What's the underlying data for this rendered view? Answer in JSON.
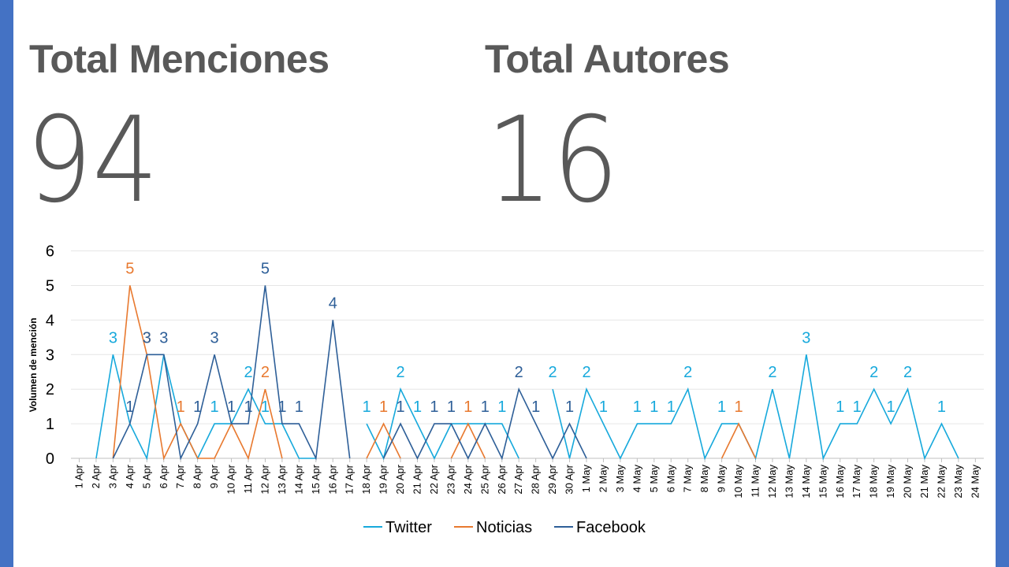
{
  "kpis": [
    {
      "label": "Total Menciones",
      "value": "94"
    },
    {
      "label": "Total Autores",
      "value": "16"
    }
  ],
  "colors": {
    "Twitter": "#17a9dc",
    "Noticias": "#e8792f",
    "Facebook": "#2e5f98"
  },
  "chart_data": {
    "type": "line",
    "ylabel": "Volumen de mención",
    "xlabel": "",
    "ylim": [
      0,
      6
    ],
    "yticks": [
      0,
      1,
      2,
      3,
      4,
      5,
      6
    ],
    "grid": true,
    "legend": "bottom",
    "categories": [
      "1 Apr",
      "2 Apr",
      "3 Apr",
      "4 Apr",
      "5 Apr",
      "6 Apr",
      "7 Apr",
      "8 Apr",
      "9 Apr",
      "10 Apr",
      "11 Apr",
      "12 Apr",
      "13 Apr",
      "14 Apr",
      "15 Apr",
      "16 Apr",
      "17 Apr",
      "18 Apr",
      "19 Apr",
      "20 Apr",
      "21 Apr",
      "22 Apr",
      "23 Apr",
      "24 Apr",
      "25 Apr",
      "26 Apr",
      "27 Apr",
      "28 Apr",
      "29 Apr",
      "30 Apr",
      "1 May",
      "2 May",
      "3 May",
      "4 May",
      "5 May",
      "6 May",
      "7 May",
      "8 May",
      "9 May",
      "10 May",
      "11 May",
      "12 May",
      "13 May",
      "14 May",
      "15 May",
      "16 May",
      "17 May",
      "18 May",
      "19 May",
      "20 May",
      "21 May",
      "22 May",
      "23 May",
      "24 May"
    ],
    "series": [
      {
        "name": "Twitter",
        "values": [
          null,
          0,
          3,
          1,
          0,
          3,
          1,
          0,
          1,
          1,
          2,
          1,
          1,
          0,
          0,
          null,
          null,
          1,
          0,
          2,
          1,
          0,
          1,
          1,
          1,
          1,
          0,
          null,
          2,
          0,
          2,
          1,
          0,
          1,
          1,
          1,
          2,
          0,
          1,
          1,
          0,
          2,
          0,
          3,
          0,
          1,
          1,
          2,
          1,
          2,
          0,
          1,
          0,
          null
        ]
      },
      {
        "name": "Noticias",
        "values": [
          null,
          null,
          0,
          5,
          3,
          0,
          1,
          0,
          0,
          1,
          0,
          2,
          0,
          null,
          null,
          null,
          null,
          0,
          1,
          0,
          null,
          null,
          0,
          1,
          0,
          null,
          null,
          null,
          null,
          null,
          null,
          null,
          null,
          null,
          null,
          null,
          null,
          null,
          0,
          1,
          0,
          null,
          null,
          null,
          null,
          null,
          null,
          null,
          null,
          null,
          null,
          null,
          null,
          null
        ]
      },
      {
        "name": "Facebook",
        "values": [
          null,
          null,
          0,
          1,
          3,
          3,
          0,
          1,
          3,
          1,
          1,
          5,
          1,
          1,
          0,
          4,
          0,
          null,
          0,
          1,
          0,
          1,
          1,
          0,
          1,
          0,
          2,
          1,
          0,
          1,
          0,
          null,
          null,
          null,
          null,
          null,
          null,
          null,
          null,
          null,
          null,
          null,
          null,
          null,
          null,
          null,
          null,
          null,
          null,
          null,
          null,
          null,
          null,
          null
        ]
      }
    ],
    "data_labels": [
      {
        "series": "Twitter",
        "index": 2,
        "text": "3"
      },
      {
        "series": "Noticias",
        "index": 3,
        "text": "5"
      },
      {
        "series": "Facebook",
        "index": 3,
        "text": "1"
      },
      {
        "series": "Noticias",
        "index": 4,
        "text": "3"
      },
      {
        "series": "Facebook",
        "index": 4,
        "text": "3"
      },
      {
        "series": "Facebook",
        "index": 5,
        "text": "3"
      },
      {
        "series": "Noticias",
        "index": 6,
        "text": "1"
      },
      {
        "series": "Facebook",
        "index": 7,
        "text": "1"
      },
      {
        "series": "Twitter",
        "index": 8,
        "text": "1"
      },
      {
        "series": "Facebook",
        "index": 8,
        "text": "3"
      },
      {
        "series": "Facebook",
        "index": 9,
        "text": "1"
      },
      {
        "series": "Twitter",
        "index": 10,
        "text": "2"
      },
      {
        "series": "Facebook",
        "index": 10,
        "text": "1"
      },
      {
        "series": "Noticias",
        "index": 11,
        "text": "2"
      },
      {
        "series": "Twitter",
        "index": 11,
        "text": "1"
      },
      {
        "series": "Facebook",
        "index": 11,
        "text": "5"
      },
      {
        "series": "Facebook",
        "index": 12,
        "text": "1"
      },
      {
        "series": "Facebook",
        "index": 13,
        "text": "1"
      },
      {
        "series": "Facebook",
        "index": 15,
        "text": "4"
      },
      {
        "series": "Twitter",
        "index": 17,
        "text": "1"
      },
      {
        "series": "Noticias",
        "index": 18,
        "text": "1"
      },
      {
        "series": "Twitter",
        "index": 19,
        "text": "2"
      },
      {
        "series": "Facebook",
        "index": 19,
        "text": "1"
      },
      {
        "series": "Twitter",
        "index": 20,
        "text": "1"
      },
      {
        "series": "Facebook",
        "index": 21,
        "text": "1"
      },
      {
        "series": "Facebook",
        "index": 22,
        "text": "1"
      },
      {
        "series": "Noticias",
        "index": 23,
        "text": "1"
      },
      {
        "series": "Facebook",
        "index": 24,
        "text": "1"
      },
      {
        "series": "Twitter",
        "index": 25,
        "text": "1"
      },
      {
        "series": "Facebook",
        "index": 26,
        "text": "2"
      },
      {
        "series": "Facebook",
        "index": 27,
        "text": "1"
      },
      {
        "series": "Twitter",
        "index": 28,
        "text": "2"
      },
      {
        "series": "Facebook",
        "index": 29,
        "text": "1"
      },
      {
        "series": "Twitter",
        "index": 30,
        "text": "2"
      },
      {
        "series": "Twitter",
        "index": 31,
        "text": "1"
      },
      {
        "series": "Twitter",
        "index": 33,
        "text": "1"
      },
      {
        "series": "Twitter",
        "index": 34,
        "text": "1"
      },
      {
        "series": "Twitter",
        "index": 35,
        "text": "1"
      },
      {
        "series": "Twitter",
        "index": 36,
        "text": "2"
      },
      {
        "series": "Twitter",
        "index": 38,
        "text": "1"
      },
      {
        "series": "Noticias",
        "index": 39,
        "text": "1"
      },
      {
        "series": "Twitter",
        "index": 41,
        "text": "2"
      },
      {
        "series": "Twitter",
        "index": 43,
        "text": "3"
      },
      {
        "series": "Twitter",
        "index": 45,
        "text": "1"
      },
      {
        "series": "Twitter",
        "index": 46,
        "text": "1"
      },
      {
        "series": "Twitter",
        "index": 47,
        "text": "2"
      },
      {
        "series": "Twitter",
        "index": 48,
        "text": "1"
      },
      {
        "series": "Twitter",
        "index": 49,
        "text": "2"
      },
      {
        "series": "Twitter",
        "index": 51,
        "text": "1"
      }
    ]
  }
}
